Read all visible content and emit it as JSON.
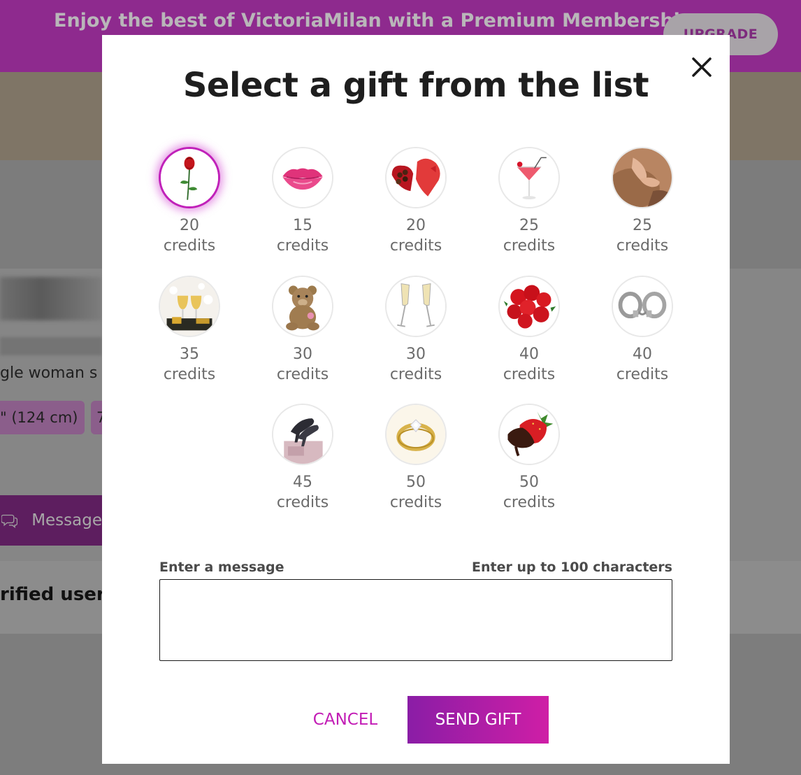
{
  "background": {
    "banner_text": "Enjoy the best of VictoriaMilan with a Premium Membership",
    "upgrade_label": "UPGRADE",
    "profile_description": "gle woman s",
    "chip_height": "\" (124 cm)",
    "chip_next": "7",
    "message_button_label": "Message",
    "verified_label": "rified user"
  },
  "modal": {
    "title": "Select a gift from the list",
    "gifts": [
      {
        "icon": "rose-icon",
        "amount": "20",
        "unit": "credits",
        "selected": true
      },
      {
        "icon": "kiss-lips-icon",
        "amount": "15",
        "unit": "credits"
      },
      {
        "icon": "chocolate-box-icon",
        "amount": "20",
        "unit": "credits"
      },
      {
        "icon": "cocktail-icon",
        "amount": "25",
        "unit": "credits"
      },
      {
        "icon": "massage-icon",
        "amount": "25",
        "unit": "credits"
      },
      {
        "icon": "champagne-celebration-icon",
        "amount": "35",
        "unit": "credits"
      },
      {
        "icon": "teddy-bear-icon",
        "amount": "30",
        "unit": "credits"
      },
      {
        "icon": "champagne-glasses-icon",
        "amount": "30",
        "unit": "credits"
      },
      {
        "icon": "rose-bouquet-icon",
        "amount": "40",
        "unit": "credits"
      },
      {
        "icon": "handcuffs-icon",
        "amount": "40",
        "unit": "credits"
      },
      {
        "icon": "high-heels-icon",
        "amount": "45",
        "unit": "credits"
      },
      {
        "icon": "diamond-ring-icon",
        "amount": "50",
        "unit": "credits"
      },
      {
        "icon": "chocolate-strawberry-icon",
        "amount": "50",
        "unit": "credits"
      }
    ],
    "message_label": "Enter a message",
    "message_limit": "Enter up to 100 characters",
    "message_value": "",
    "cancel_label": "CANCEL",
    "send_label": "SEND GIFT"
  },
  "colors": {
    "accent": "#c21cb5",
    "send_gradient_start": "#8a1da6",
    "send_gradient_end": "#cf1ea6",
    "selected_border": "#c021b9"
  }
}
